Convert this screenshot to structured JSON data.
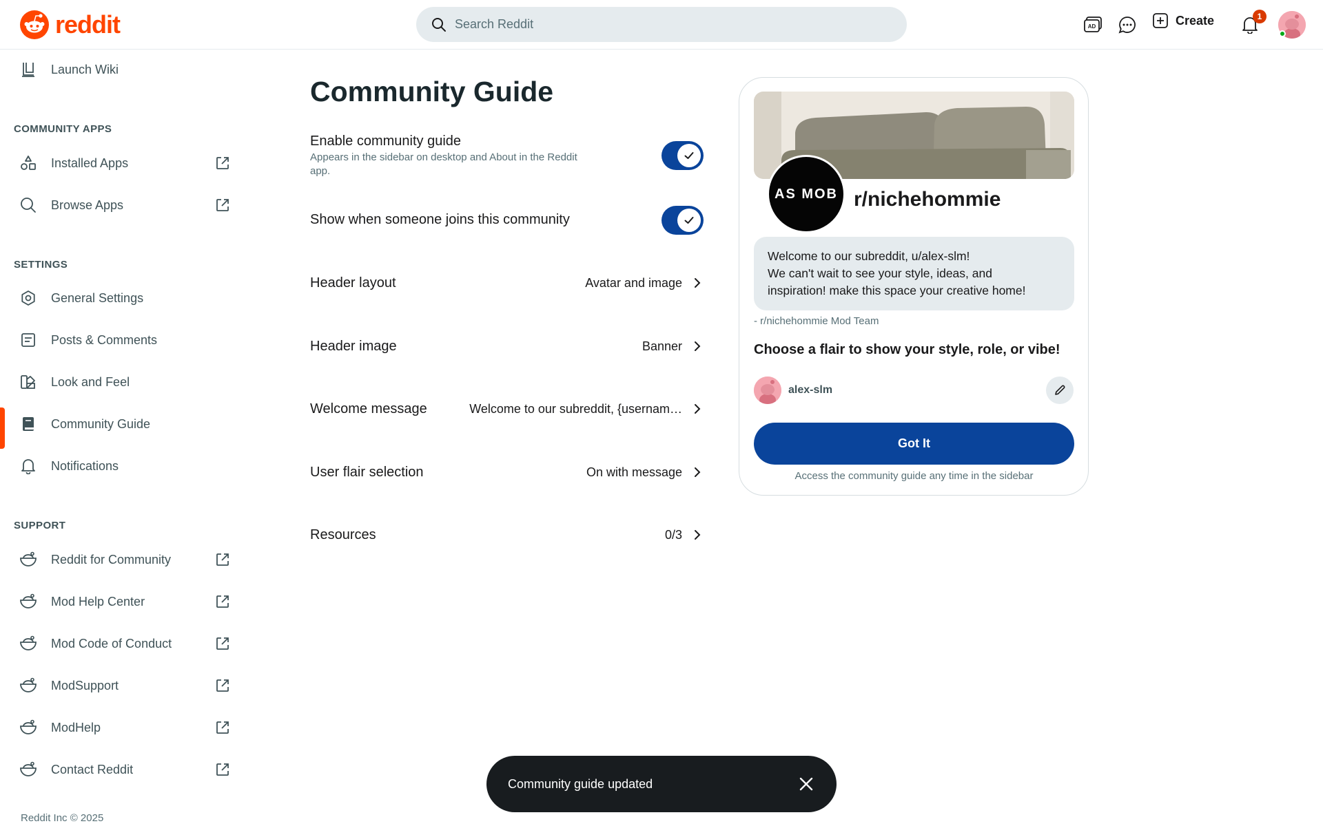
{
  "header": {
    "logo_text": "reddit",
    "search_placeholder": "Search Reddit",
    "create_label": "Create",
    "notification_count": "1",
    "brand_color": "#ff4500",
    "icons": [
      "advertise-icon",
      "chat-icon",
      "create-plus-icon",
      "notification-bell-icon",
      "user-avatar"
    ]
  },
  "sidebar": {
    "top_item": {
      "label": "Launch Wiki",
      "icon": "wiki-icon"
    },
    "community_apps": {
      "heading": "COMMUNITY APPS",
      "items": [
        {
          "label": "Installed Apps",
          "icon": "apps-icon",
          "external": true
        },
        {
          "label": "Browse Apps",
          "icon": "search-icon",
          "external": true
        }
      ]
    },
    "settings": {
      "heading": "SETTINGS",
      "items": [
        {
          "label": "General Settings",
          "icon": "gear-icon"
        },
        {
          "label": "Posts & Comments",
          "icon": "posts-icon"
        },
        {
          "label": "Look and Feel",
          "icon": "palette-icon"
        },
        {
          "label": "Community Guide",
          "icon": "book-icon",
          "active": true
        },
        {
          "label": "Notifications",
          "icon": "bell-icon"
        }
      ]
    },
    "support": {
      "heading": "SUPPORT",
      "items": [
        {
          "label": "Reddit for Community",
          "icon": "snoo-icon",
          "external": true
        },
        {
          "label": "Mod Help Center",
          "icon": "snoo-icon",
          "external": true
        },
        {
          "label": "Mod Code of Conduct",
          "icon": "snoo-icon",
          "external": true
        },
        {
          "label": "ModSupport",
          "icon": "snoo-icon",
          "external": true
        },
        {
          "label": "ModHelp",
          "icon": "snoo-icon",
          "external": true
        },
        {
          "label": "Contact Reddit",
          "icon": "snoo-icon",
          "external": true
        }
      ]
    },
    "footer": "Reddit Inc © 2025"
  },
  "main": {
    "title": "Community Guide",
    "toggles": [
      {
        "label": "Enable community guide",
        "description": "Appears in the sidebar on desktop and About in the Reddit app.",
        "on": true
      },
      {
        "label": "Show when someone joins this community",
        "description": "",
        "on": true
      }
    ],
    "rows": [
      {
        "label": "Header layout",
        "value": "Avatar and image"
      },
      {
        "label": "Header image",
        "value": "Banner"
      },
      {
        "label": "Welcome message",
        "value": "Welcome to our subreddit, {usernam…"
      },
      {
        "label": "User flair selection",
        "value": "On with message"
      },
      {
        "label": "Resources",
        "value": "0/3"
      }
    ]
  },
  "preview": {
    "avatar_text": "AS MOB",
    "community_name": "r/nichehommie",
    "welcome_lines": [
      "Welcome to our subreddit, u/alex-slm!",
      "We can't wait to see your style, ideas, and",
      "inspiration! make this space your creative home!"
    ],
    "mod_team": "- r/nichehommie Mod Team",
    "flair_heading": "Choose a flair to show your style, role, or vibe!",
    "username": "alex-slm",
    "button_label": "Got It",
    "access_note": "Access the community guide any time in the sidebar",
    "button_color": "#0a449b"
  },
  "toast": {
    "message": "Community guide updated"
  }
}
